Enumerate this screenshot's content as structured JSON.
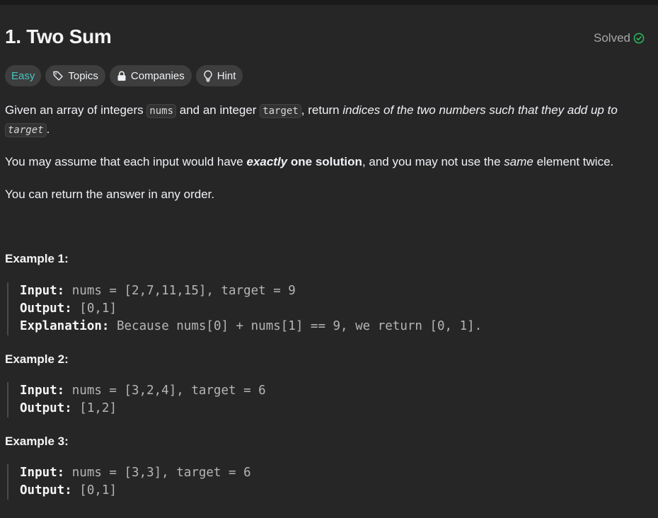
{
  "problem": {
    "title": "1. Two Sum",
    "status": "Solved"
  },
  "tags": {
    "difficulty": "Easy",
    "topics": "Topics",
    "companies": "Companies",
    "hint": "Hint"
  },
  "description": {
    "p1_a": "Given an array of integers ",
    "p1_code1": "nums",
    "p1_b": " and an integer ",
    "p1_code2": "target",
    "p1_c": ", return ",
    "p1_italic": "indices of the two numbers such that they add up to ",
    "p1_code3": "target",
    "p1_d": ".",
    "p2_a": "You may assume that each input would have ",
    "p2_bold_italic": "exactly",
    "p2_bold": " one solution",
    "p2_b": ", and you may not use the ",
    "p2_italic": "same",
    "p2_c": " element twice.",
    "p3": "You can return the answer in any order."
  },
  "examples": [
    {
      "heading": "Example 1:",
      "input_label": "Input:",
      "input_value": " nums = [2,7,11,15], target = 9",
      "output_label": "Output:",
      "output_value": " [0,1]",
      "explanation_label": "Explanation:",
      "explanation_value": " Because nums[0] + nums[1] == 9, we return [0, 1]."
    },
    {
      "heading": "Example 2:",
      "input_label": "Input:",
      "input_value": " nums = [3,2,4], target = 6",
      "output_label": "Output:",
      "output_value": " [1,2]"
    },
    {
      "heading": "Example 3:",
      "input_label": "Input:",
      "input_value": " nums = [3,3], target = 6",
      "output_label": "Output:",
      "output_value": " [0,1]"
    }
  ],
  "colors": {
    "background": "#262626",
    "easy": "#46c6c2",
    "solved_check": "#2cbb5d",
    "tag_bg": "#3e3e3e"
  },
  "icons": {
    "solved": "check-circle-icon",
    "topics": "tag-icon",
    "companies": "lock-icon",
    "hint": "lightbulb-icon"
  }
}
